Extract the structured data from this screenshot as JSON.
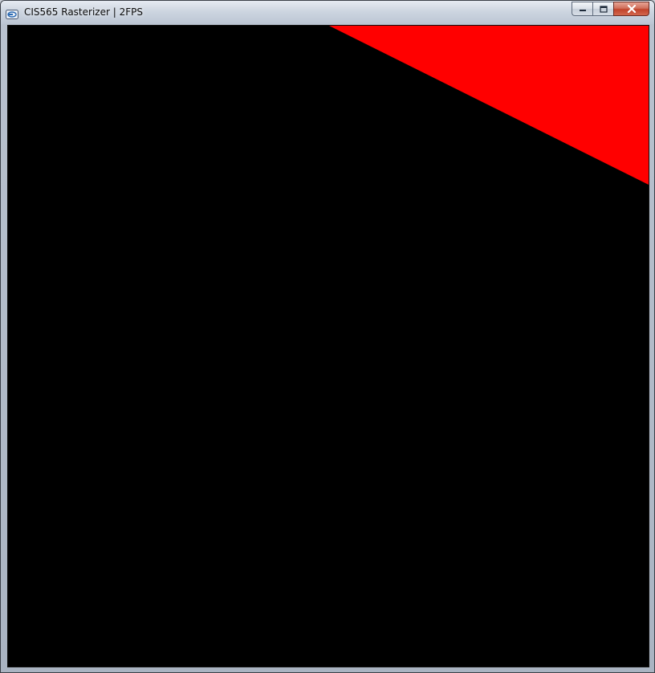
{
  "window": {
    "title": "CIS565 Rasterizer | 2FPS"
  },
  "controls": {
    "minimize_icon": "minimize-icon",
    "maximize_icon": "maximize-icon",
    "close_icon": "close-icon"
  },
  "viewport": {
    "background_color": "#000000",
    "triangle_color": "#ff0000"
  }
}
